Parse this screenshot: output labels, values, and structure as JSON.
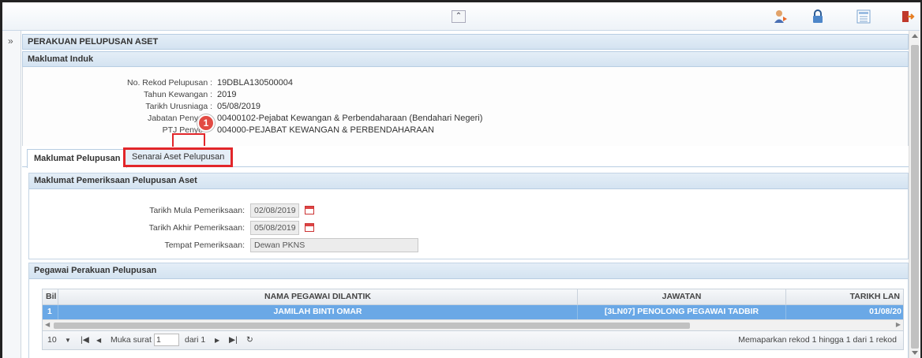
{
  "topbar": {
    "collapse_icon": "double-chevron-up-icon",
    "icons": [
      "user-switch-icon",
      "lock-icon",
      "list-view-icon",
      "logout-icon"
    ]
  },
  "left_strip": {
    "expand_glyph": "»"
  },
  "page_title": "PERAKUAN PELUPUSAN ASET",
  "induk": {
    "header": "Maklumat Induk",
    "fields": [
      {
        "label": "No. Rekod Pelupusan :",
        "value": "19DBLA130500004"
      },
      {
        "label": "Tahun Kewangan :",
        "value": "2019"
      },
      {
        "label": "Tarikh Urusniaga :",
        "value": "05/08/2019"
      },
      {
        "label": "Jabatan Penye",
        "value": "00400102-Pejabat Kewangan & Perbendaharaan (Bendahari Negeri)"
      },
      {
        "label": "PTJ Penye",
        "value": "004000-PEJABAT KEWANGAN & PERBENDAHARAAN"
      }
    ],
    "callout_number": "1"
  },
  "tabs": [
    {
      "label": "Maklumat Pelupusan",
      "active": true
    },
    {
      "label": "Senarai Aset Pelupusan",
      "highlighted": true
    }
  ],
  "pemeriksaan": {
    "header": "Maklumat Pemeriksaan Pelupusan Aset",
    "mula_label": "Tarikh Mula Pemeriksaan:",
    "mula_value": "02/08/2019",
    "akhir_label": "Tarikh Akhir Pemeriksaan:",
    "akhir_value": "05/08/2019",
    "tempat_label": "Tempat Pemeriksaan:",
    "tempat_value": "Dewan PKNS"
  },
  "pegawai": {
    "header": "Pegawai Perakuan Pelupusan",
    "columns": [
      "Bil",
      "NAMA PEGAWAI DILANTIK",
      "JAWATAN",
      "TARIKH LAN"
    ],
    "rows": [
      {
        "bil": "1",
        "nama": "JAMILAH BINTI OMAR",
        "jawatan": "[3LN07] PENOLONG PEGAWAI TADBIR",
        "tarikh": "01/08/20"
      }
    ],
    "pager": {
      "page_size": "10",
      "page_label": "Muka surat",
      "page_value": "1",
      "of_label": "dari 1",
      "summary": "Memaparkan rekod 1 hingga 1 dari 1 rekod"
    }
  },
  "colors": {
    "accent_red": "#e2262a",
    "selected_row": "#6aa8e6",
    "header_bg": "#d4e3f1"
  }
}
